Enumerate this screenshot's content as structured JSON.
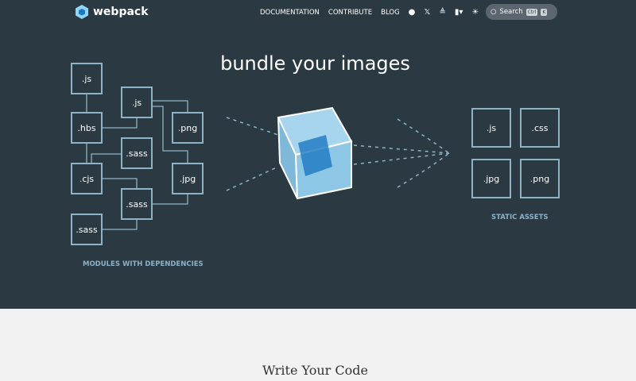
{
  "nav": {
    "brand": "webpack",
    "links": [
      "DOCUMENTATION",
      "CONTRIBUTE",
      "BLOG"
    ],
    "search_label": "Search",
    "kbd": [
      "Ctrl",
      "K"
    ]
  },
  "hero": {
    "title": "bundle your images",
    "modules_caption": "MODULES WITH DEPENDENCIES",
    "assets_caption": "STATIC ASSETS",
    "modules": [
      ".js",
      ".hbs",
      ".js",
      ".png",
      ".sass",
      ".cjs",
      ".jpg",
      ".sass",
      ".sass"
    ],
    "assets": [
      ".js",
      ".css",
      ".jpg",
      ".png"
    ]
  },
  "section": {
    "title": "Write Your Code"
  }
}
